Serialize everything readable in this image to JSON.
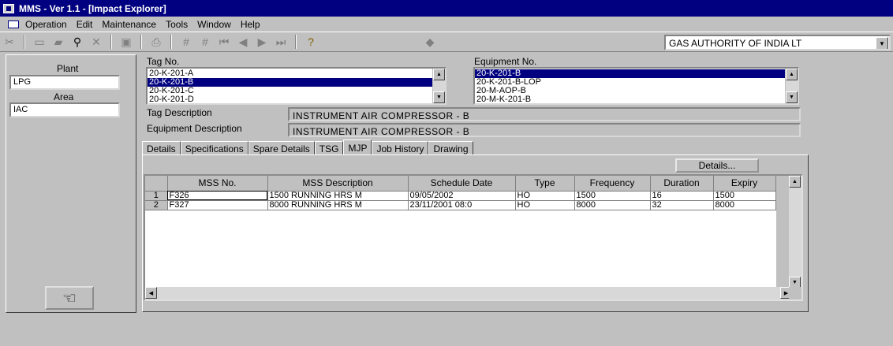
{
  "window": {
    "title": "MMS - Ver 1.1 - [Impact Explorer]"
  },
  "menu": [
    "Operation",
    "Edit",
    "Maintenance",
    "Tools",
    "Window",
    "Help"
  ],
  "toolbar": {
    "company": "GAS AUTHORITY OF INDIA LT"
  },
  "left": {
    "plant_label": "Plant",
    "plant_value": "LPG",
    "area_label": "Area",
    "area_value": "IAC"
  },
  "tag": {
    "label": "Tag No.",
    "items": [
      "20-K-201-A",
      "20-K-201-B",
      "20-K-201-C",
      "20-K-201-D"
    ],
    "selected_index": 1
  },
  "equipment": {
    "label": "Equipment No.",
    "items": [
      "20-K-201-B",
      "20-K-201-B-LOP",
      "20-M-AOP-B",
      "20-M-K-201-B"
    ],
    "selected_index": 0
  },
  "tag_description": {
    "label": "Tag Description",
    "value": "INSTRUMENT AIR COMPRESSOR - B"
  },
  "equipment_description": {
    "label": "Equipment Description",
    "value": "INSTRUMENT AIR COMPRESSOR - B"
  },
  "tabs": [
    "Details",
    "Specifications",
    "Spare Details",
    "TSG",
    "MJP",
    "Job History",
    "Drawing"
  ],
  "active_tab": "MJP",
  "details_button": "Details...",
  "grid": {
    "columns": [
      "MSS No.",
      "MSS Description",
      "Schedule Date",
      "Type",
      "Frequency",
      "Duration",
      "Expiry"
    ],
    "rows": [
      {
        "n": "1",
        "mss_no": "F326",
        "desc": "1500 RUNNING HRS M",
        "date": "09/05/2002",
        "type": "HO",
        "freq": "1500",
        "dur": "16",
        "exp": "1500"
      },
      {
        "n": "2",
        "mss_no": "F327",
        "desc": "8000 RUNNING HRS M",
        "date": "23/11/2001 08:0",
        "type": "HO",
        "freq": "8000",
        "dur": "32",
        "exp": "8000"
      }
    ]
  }
}
